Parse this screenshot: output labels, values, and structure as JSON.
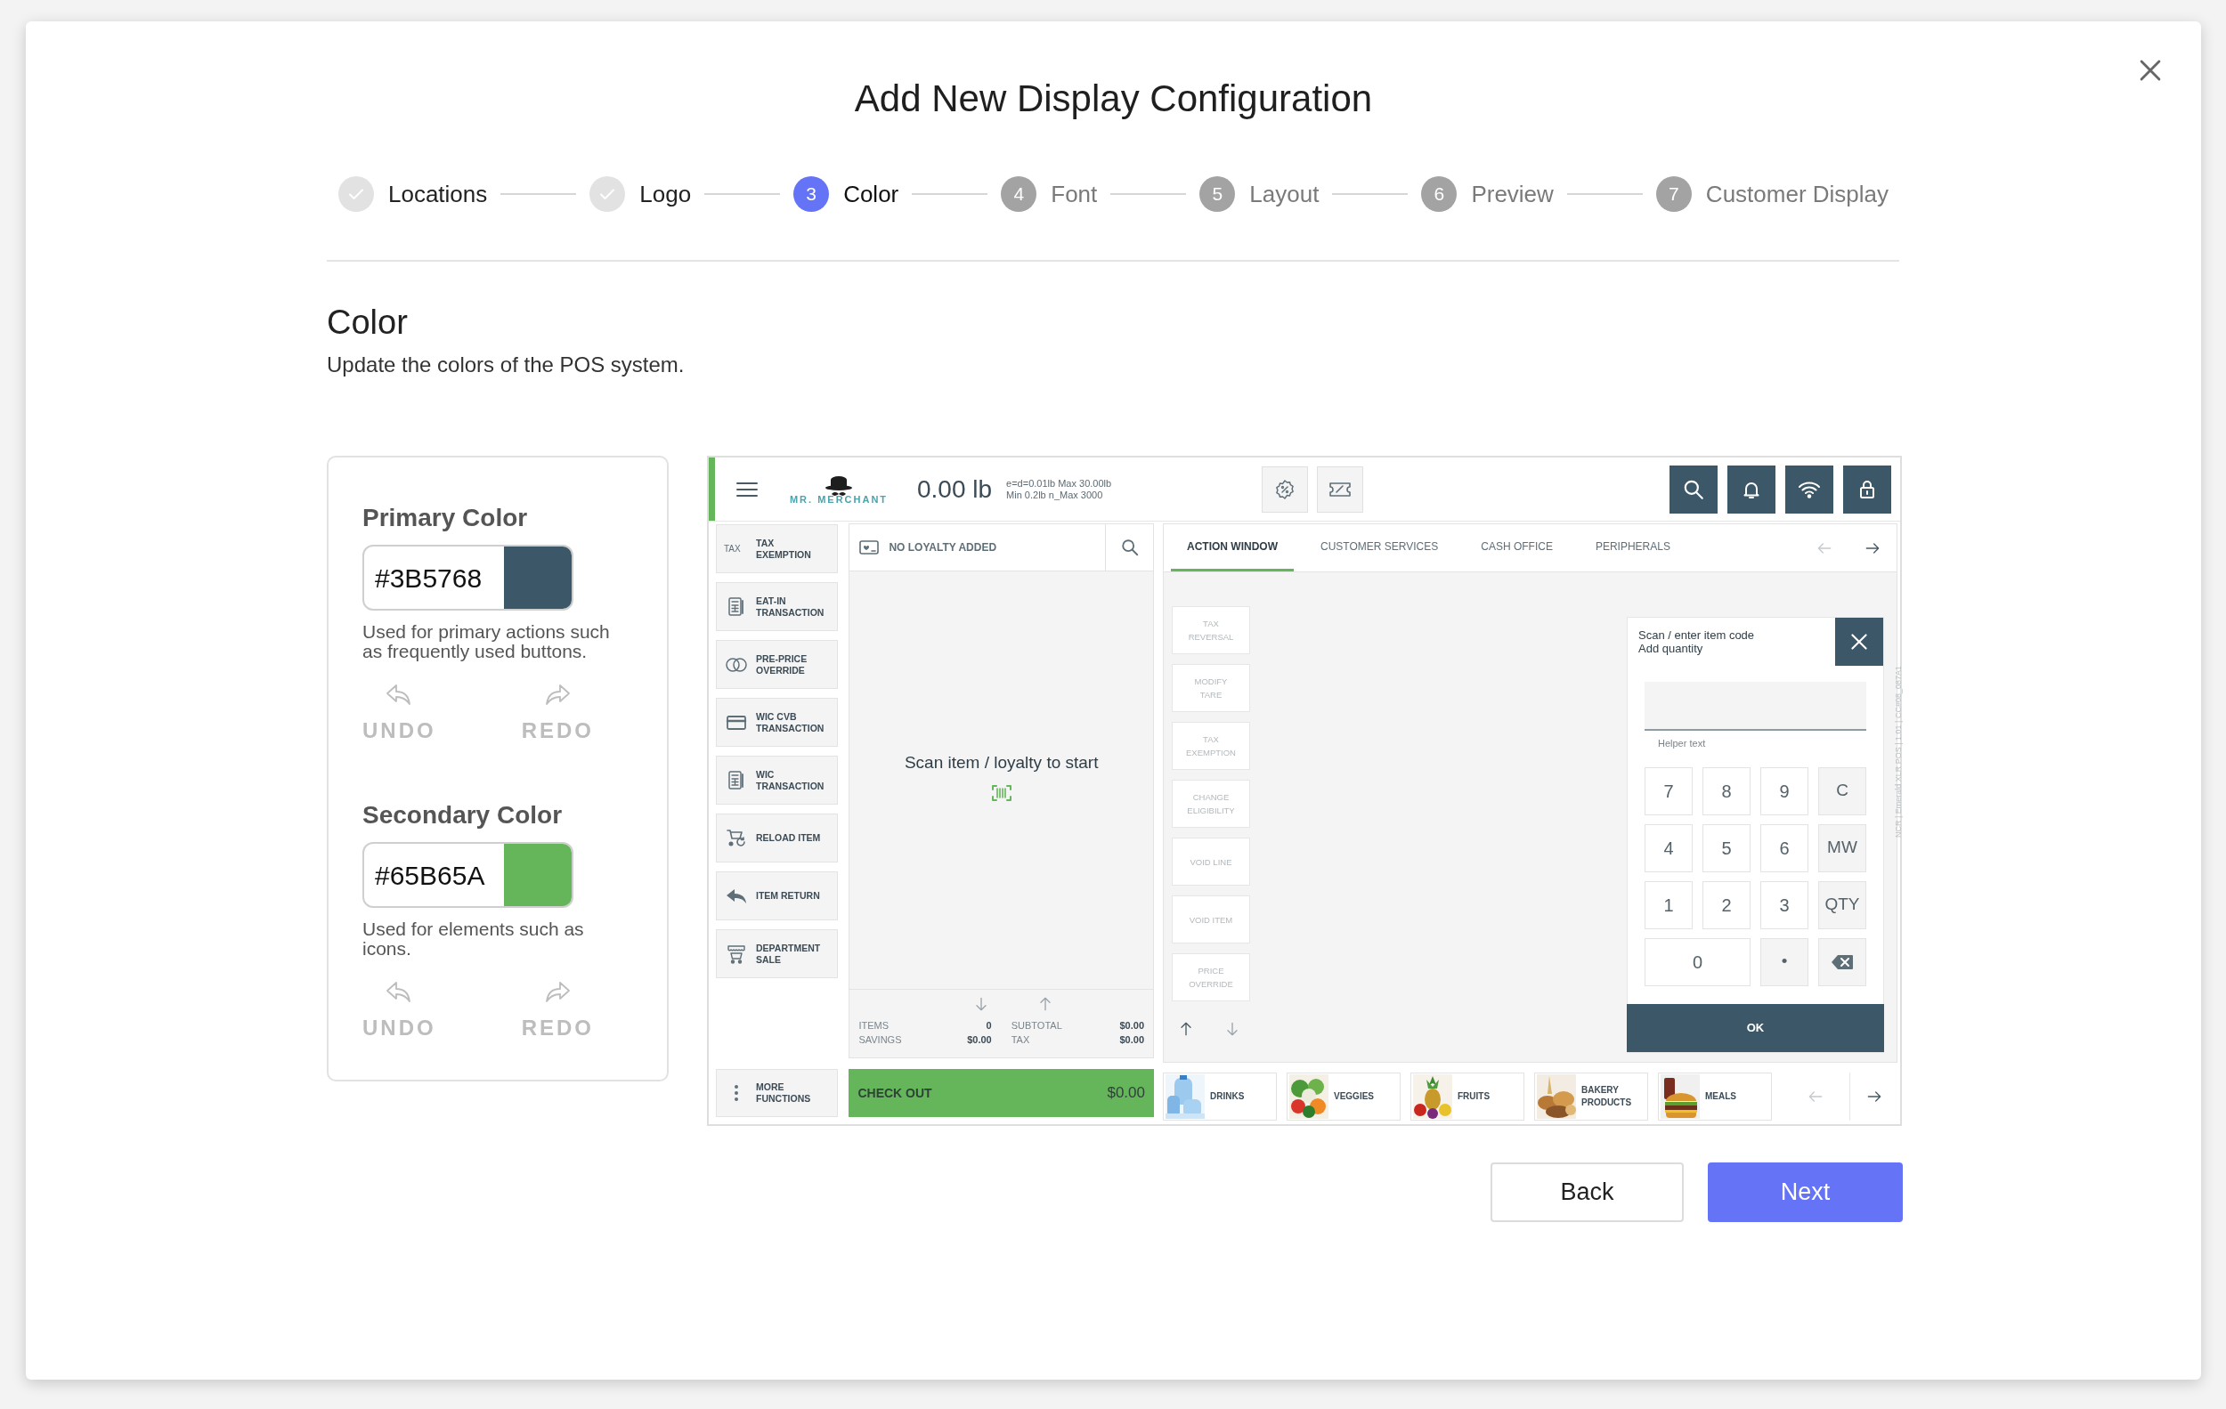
{
  "dialog": {
    "title": "Add New Display Configuration"
  },
  "steps": [
    {
      "label": "Locations",
      "completed": true,
      "selected": false
    },
    {
      "label": "Logo",
      "completed": true,
      "selected": false
    },
    {
      "number": "3",
      "label": "Color",
      "completed": false,
      "selected": true
    },
    {
      "number": "4",
      "label": "Font",
      "completed": false,
      "selected": false
    },
    {
      "number": "5",
      "label": "Layout",
      "completed": false,
      "selected": false
    },
    {
      "number": "6",
      "label": "Preview",
      "completed": false,
      "selected": false
    },
    {
      "number": "7",
      "label": "Customer Display",
      "completed": false,
      "selected": false
    }
  ],
  "section": {
    "title": "Color",
    "subtitle": "Update the colors of the POS system."
  },
  "color_settings": [
    {
      "title": "Primary Color",
      "value": "#3B5768",
      "color": "#3b5768",
      "description": "Used for primary actions such as frequently used buttons.",
      "undo": {
        "label": "UNDO",
        "disabled": true
      },
      "redo": {
        "label": "REDO",
        "disabled": true
      }
    },
    {
      "title": "Secondary Color",
      "value": "#65B65A",
      "color": "#65b65a",
      "description": "Used for elements such as icons.",
      "undo": {
        "label": "UNDO",
        "disabled": true
      },
      "redo": {
        "label": "REDO",
        "disabled": true
      }
    }
  ],
  "pos_preview": {
    "logo": "MR. MERCHANT",
    "weight": "0.00 lb",
    "scale_info": [
      "e=d=0.01lb Max 30.00lb",
      "Min 0.2lb n_Max 3000"
    ],
    "functions": [
      {
        "badge": "TAX",
        "label": "TAX EXEMPTION"
      },
      {
        "label": "EAT-IN TRANSACTION"
      },
      {
        "label": "PRE-PRICE OVERRIDE"
      },
      {
        "label": "WIC CVB TRANSACTION"
      },
      {
        "label": "WIC TRANSACTION"
      },
      {
        "label": "RELOAD ITEM"
      },
      {
        "label": "ITEM RETURN"
      },
      {
        "label": "DEPARTMENT SALE"
      }
    ],
    "more_functions": "MORE FUNCTIONS",
    "loyalty": "NO LOYALTY ADDED",
    "prompt": "Scan item / loyalty to start",
    "totals": [
      {
        "label": "ITEMS",
        "value": "0"
      },
      {
        "label": "SUBTOTAL",
        "value": "$0.00"
      },
      {
        "label": "SAVINGS",
        "value": "$0.00"
      },
      {
        "label": "TAX",
        "value": "$0.00"
      }
    ],
    "checkout": {
      "label": "CHECK OUT",
      "amount": "$0.00"
    },
    "tabs": [
      {
        "label": "ACTION WINDOW",
        "selected": true
      },
      {
        "label": "CUSTOMER SERVICES",
        "selected": false
      },
      {
        "label": "CASH OFFICE",
        "selected": false
      },
      {
        "label": "PERIPHERALS",
        "selected": false
      }
    ],
    "actions": [
      {
        "label": "TAX REVERSAL",
        "disabled": true
      },
      {
        "label": "MODIFY TARE",
        "disabled": true
      },
      {
        "label": "TAX EXEMPTION",
        "disabled": true
      },
      {
        "label": "CHANGE ELIGIBILITY",
        "disabled": true
      },
      {
        "label": "VOID LINE",
        "disabled": true
      },
      {
        "label": "VOID ITEM",
        "disabled": true
      },
      {
        "label": "PRICE OVERRIDE",
        "disabled": true
      }
    ],
    "keypad": {
      "title": "Scan / enter item code",
      "subtitle": "Add quantity",
      "helper": "Helper text",
      "ok": "OK",
      "keys": [
        {
          "label": "7",
          "kind": "digit"
        },
        {
          "label": "8",
          "kind": "digit"
        },
        {
          "label": "9",
          "kind": "digit"
        },
        {
          "label": "C",
          "kind": "function"
        },
        {
          "label": "4",
          "kind": "digit"
        },
        {
          "label": "5",
          "kind": "digit"
        },
        {
          "label": "6",
          "kind": "digit"
        },
        {
          "label": "MW",
          "kind": "function"
        },
        {
          "label": "1",
          "kind": "digit"
        },
        {
          "label": "2",
          "kind": "digit"
        },
        {
          "label": "3",
          "kind": "digit"
        },
        {
          "label": "QTY",
          "kind": "function"
        },
        {
          "label": "0",
          "kind": "digit_wide"
        },
        {
          "label": "•",
          "kind": "function"
        },
        {
          "kind": "backspace"
        }
      ]
    },
    "categories": [
      "DRINKS",
      "VEGGIES",
      "FRUITS",
      "BAKERY PRODUCTS",
      "MEALS"
    ],
    "version": "NCR | Emerald XLR POS | 1.01 | CC#08_087A1"
  },
  "buttons": {
    "back": "Back",
    "next": "Next"
  }
}
